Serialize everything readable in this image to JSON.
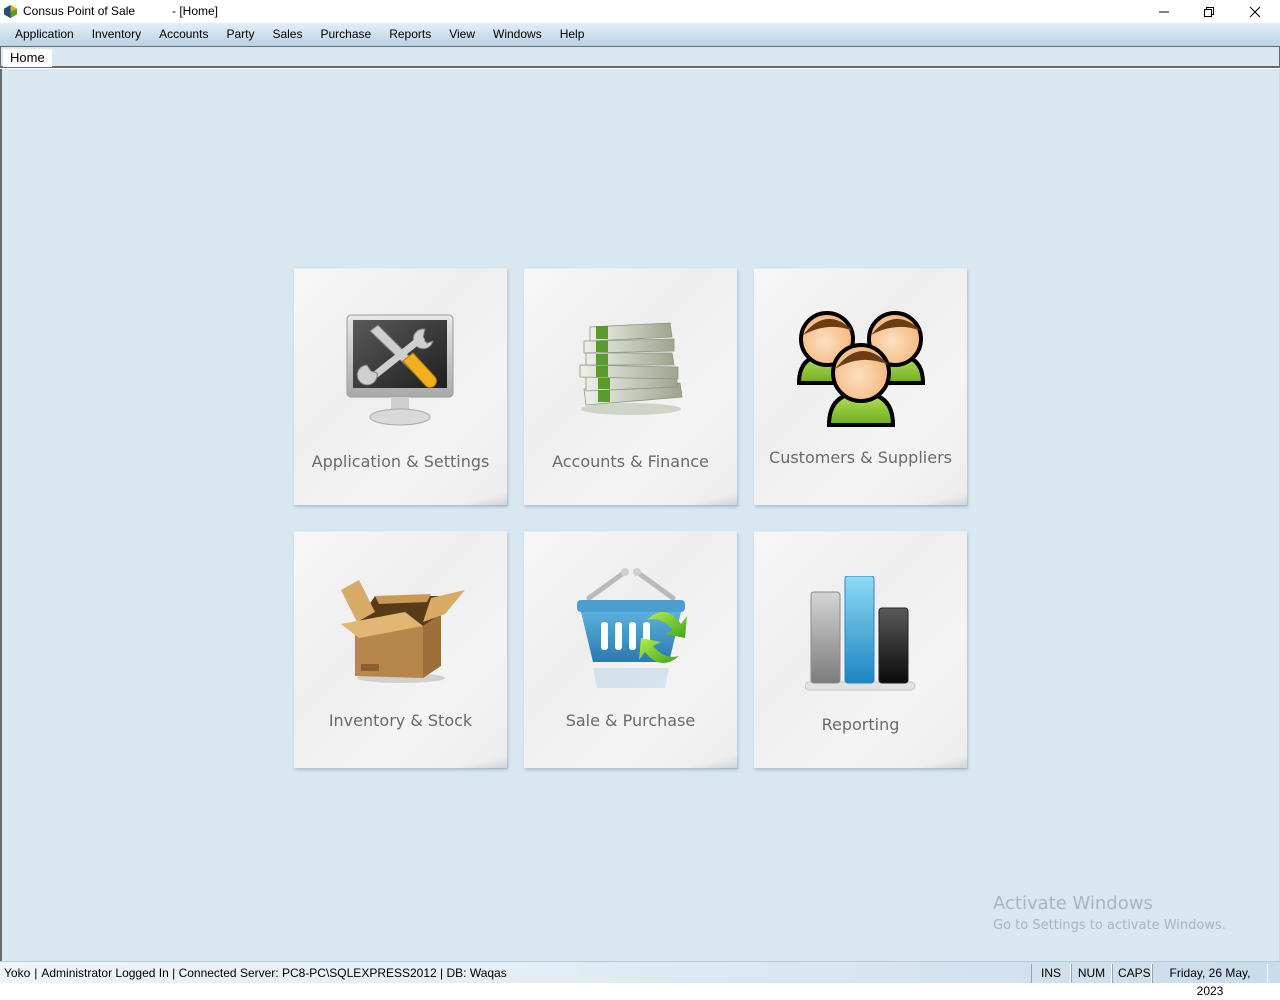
{
  "window": {
    "app_title": "Consus Point of Sale",
    "document_title": "- [Home]",
    "controls": {
      "minimize": "minimize-icon",
      "restore": "restore-icon",
      "close": "close-icon"
    }
  },
  "menu": {
    "items": [
      "Application",
      "Inventory",
      "Accounts",
      "Party",
      "Sales",
      "Purchase",
      "Reports",
      "View",
      "Windows",
      "Help"
    ]
  },
  "tabs": {
    "active": "Home"
  },
  "tiles": [
    {
      "label": "Application & Settings",
      "icon": "monitor-tools-icon"
    },
    {
      "label": "Accounts & Finance",
      "icon": "money-stack-icon"
    },
    {
      "label": "Customers & Suppliers",
      "icon": "people-group-icon"
    },
    {
      "label": "Inventory & Stock",
      "icon": "cardboard-box-icon"
    },
    {
      "label": "Sale & Purchase",
      "icon": "shopping-basket-icon"
    },
    {
      "label": "Reporting",
      "icon": "bar-chart-icon"
    }
  ],
  "watermark": {
    "title": "Activate Windows",
    "subtitle": "Go to Settings to activate Windows."
  },
  "statusbar": {
    "user": "Yoko",
    "separator": "|",
    "info": "Administrator Logged In | Connected Server: PC8-PC\\SQLEXPRESS2012 | DB: Waqas",
    "ins": "INS",
    "num": "NUM",
    "caps": "CAPS",
    "date": "Friday, 26 May, 2023"
  },
  "colors": {
    "workspace_bg": "#d9e7f1",
    "tile_label": "#6a6a6a",
    "menubar_bottom": "#b7d3e3"
  }
}
